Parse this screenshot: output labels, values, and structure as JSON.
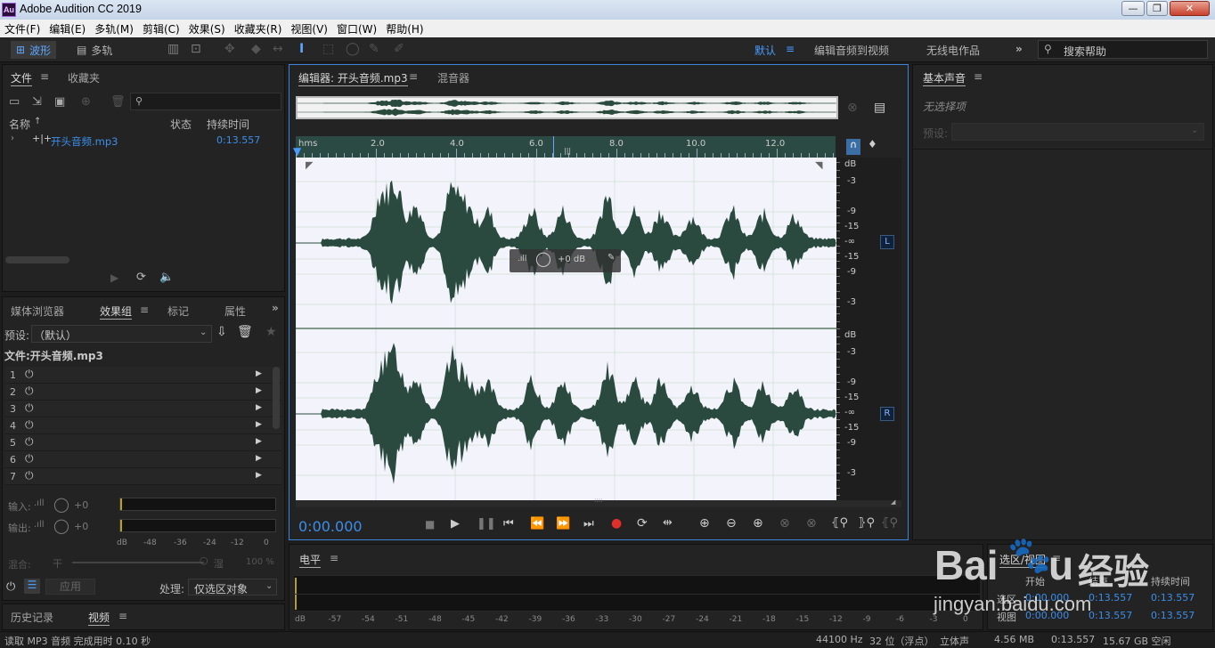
{
  "window": {
    "title": "Adobe Audition CC 2019",
    "icon_label": "Au",
    "minimize": "—",
    "maximize": "❐",
    "close": "✕"
  },
  "menu": [
    "文件(F)",
    "编辑(E)",
    "多轨(M)",
    "剪辑(C)",
    "效果(S)",
    "收藏夹(R)",
    "视图(V)",
    "窗口(W)",
    "帮助(H)"
  ],
  "toolbar": {
    "waveform_label": "波形",
    "multitrack_label": "多轨",
    "workspaces": [
      "默认",
      "编辑音频到视频",
      "无线电作品"
    ],
    "more": "»",
    "search_placeholder": "搜索帮助"
  },
  "files_panel": {
    "tabs": [
      "文件",
      "收藏夹"
    ],
    "columns": {
      "name": "名称",
      "status": "状态",
      "duration": "持续时间"
    },
    "file": {
      "name": "开头音频.mp3",
      "duration": "0:13.557"
    }
  },
  "effects_panel": {
    "tabs": [
      "媒体浏览器",
      "效果组",
      "标记",
      "属性"
    ],
    "preset_label": "预设:",
    "preset_value": "（默认）",
    "file_title": "文件:开头音频.mp3",
    "slots": [
      "1",
      "2",
      "3",
      "4",
      "5",
      "6",
      "7"
    ],
    "input_label": "输入:",
    "output_label": "输出:",
    "input_value": "+0",
    "output_value": "+0",
    "meter_scale": [
      "dB",
      "-48",
      "-36",
      "-24",
      "-12",
      "0"
    ],
    "mix_label": "混合:",
    "dry_label": "干",
    "wet_label": "湿",
    "mix_value": "100 %",
    "apply_label": "应用",
    "process_label": "处理:",
    "process_value": "仅选区对象"
  },
  "bottom_left_tabs": [
    "历史记录",
    "视频"
  ],
  "editor": {
    "tab": "编辑器: 开头音频.mp3",
    "mixer_tab": "混音器",
    "ruler": [
      "hms",
      "2.0",
      "4.0",
      "6.0",
      "8.0",
      "10.0",
      "12.0"
    ],
    "db_scale": [
      "dB",
      "-3",
      "-9",
      "-15",
      "-∞",
      "-15",
      "-9",
      "-3"
    ],
    "channel_left": "L",
    "channel_right": "R",
    "hud_value": "+0 dB",
    "timecode": "0:00.000"
  },
  "essential_sound": {
    "title": "基本声音",
    "no_selection": "无选择项",
    "preset_label": "预设:"
  },
  "levels_panel": {
    "title": "电平",
    "scale": [
      "dB",
      "-57",
      "-54",
      "-51",
      "-48",
      "-45",
      "-42",
      "-39",
      "-36",
      "-33",
      "-30",
      "-27",
      "-24",
      "-21",
      "-18",
      "-15",
      "-12",
      "-9",
      "-6",
      "-3",
      "0"
    ]
  },
  "selection_panel": {
    "title": "选区/视图",
    "columns": [
      "开始",
      "结束",
      "持续时间"
    ],
    "rows": [
      {
        "label": "选区",
        "start": "0:00.000",
        "end": "0:13.557",
        "duration": "0:13.557"
      },
      {
        "label": "视图",
        "start": "0:00.000",
        "end": "0:13.557",
        "duration": "0:13.557"
      }
    ]
  },
  "status": {
    "message": "读取 MP3 音频 完成用时 0.10 秒",
    "sample_rate": "44100 Hz",
    "bit_depth": "32 位（浮点）",
    "channels": "立体声",
    "file_size": "4.56 MB",
    "duration": "0:13.557",
    "free_space": "15.67 GB 空闲"
  },
  "watermark": {
    "brand": "Bai",
    "brand_end": "u",
    "cn": "经验",
    "url": "jingyan.baidu.com"
  },
  "colors": {
    "accent": "#3b8eea",
    "waveform": "#2b4a3f",
    "waveform_bg": "#f3f4fb",
    "record": "#e0302a"
  }
}
